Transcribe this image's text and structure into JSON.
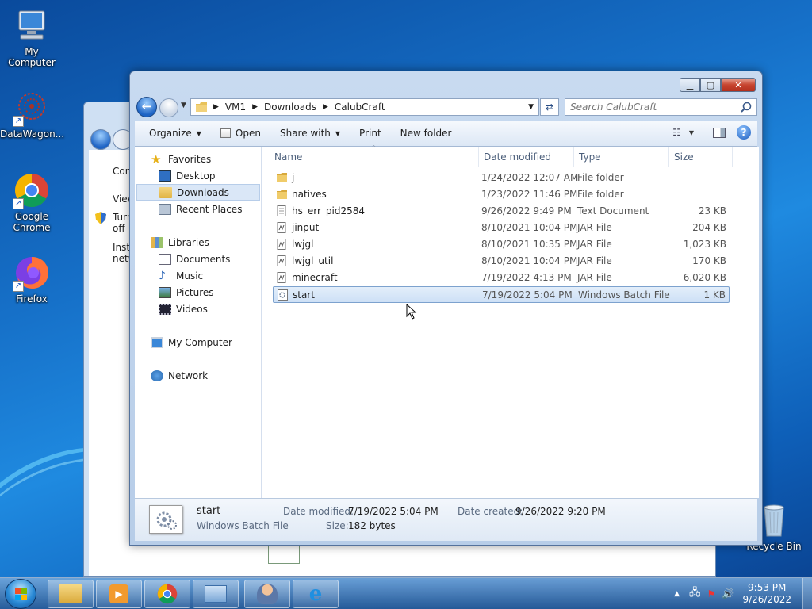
{
  "desktop": {
    "icons": [
      {
        "label": "My Computer",
        "icon": "computer-icon"
      },
      {
        "label": "DataWagon...",
        "icon": "datawagon-icon"
      },
      {
        "label": "Google Chrome",
        "icon": "chrome-icon"
      },
      {
        "label": "Firefox",
        "icon": "firefox-icon"
      },
      {
        "label": "Recycle Bin",
        "icon": "recycle-bin-icon"
      }
    ]
  },
  "background_window": {
    "lines": [
      "Con",
      "View",
      "Turn off",
      "Insta netw"
    ]
  },
  "explorer": {
    "address": {
      "crumbs": [
        "VM1",
        "Downloads",
        "CalubCraft"
      ]
    },
    "search": {
      "placeholder": "Search CalubCraft"
    },
    "toolbar": {
      "organize": "Organize",
      "open": "Open",
      "share_with": "Share with",
      "print": "Print",
      "new_folder": "New folder"
    },
    "nav_pane": {
      "favorites": "Favorites",
      "desktop": "Desktop",
      "downloads": "Downloads",
      "recent_places": "Recent Places",
      "libraries": "Libraries",
      "documents": "Documents",
      "music": "Music",
      "pictures": "Pictures",
      "videos": "Videos",
      "my_computer": "My Computer",
      "network": "Network"
    },
    "columns": {
      "name": "Name",
      "date_modified": "Date modified",
      "type": "Type",
      "size": "Size"
    },
    "files": [
      {
        "name": "j",
        "date": "1/24/2022 12:07 AM",
        "type": "File folder",
        "size": "",
        "icon": "folder-icon"
      },
      {
        "name": "natives",
        "date": "1/23/2022 11:46 PM",
        "type": "File folder",
        "size": "",
        "icon": "folder-icon"
      },
      {
        "name": "hs_err_pid2584",
        "date": "9/26/2022 9:49 PM",
        "type": "Text Document",
        "size": "23 KB",
        "icon": "text-file-icon"
      },
      {
        "name": "jinput",
        "date": "8/10/2021 10:04 PM",
        "type": "JAR File",
        "size": "204 KB",
        "icon": "jar-file-icon"
      },
      {
        "name": "lwjgl",
        "date": "8/10/2021 10:35 PM",
        "type": "JAR File",
        "size": "1,023 KB",
        "icon": "jar-file-icon"
      },
      {
        "name": "lwjgl_util",
        "date": "8/10/2021 10:04 PM",
        "type": "JAR File",
        "size": "170 KB",
        "icon": "jar-file-icon"
      },
      {
        "name": "minecraft",
        "date": "7/19/2022 4:13 PM",
        "type": "JAR File",
        "size": "6,020 KB",
        "icon": "jar-file-icon"
      },
      {
        "name": "start",
        "date": "7/19/2022 5:04 PM",
        "type": "Windows Batch File",
        "size": "1 KB",
        "icon": "batch-file-icon",
        "selected": true
      }
    ],
    "details": {
      "name": "start",
      "type": "Windows Batch File",
      "date_modified_label": "Date modified:",
      "date_modified": "7/19/2022 5:04 PM",
      "size_label": "Size:",
      "size": "182 bytes",
      "date_created_label": "Date created:",
      "date_created": "9/26/2022 9:20 PM"
    }
  },
  "taskbar": {
    "time": "9:53 PM",
    "date": "9/26/2022",
    "apps": [
      "explorer-icon",
      "media-player-icon",
      "chrome-icon",
      "control-panel-icon",
      "users-icon",
      "internet-explorer-icon"
    ]
  }
}
